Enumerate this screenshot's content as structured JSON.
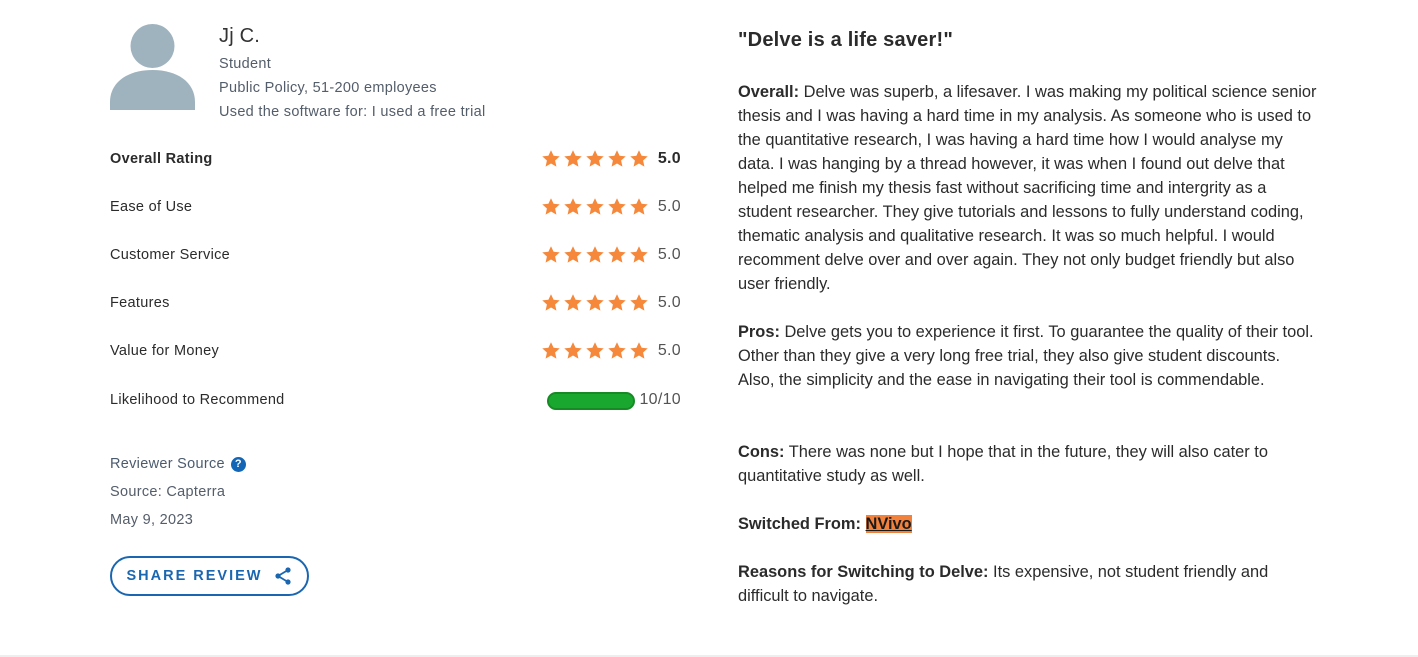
{
  "reviewer": {
    "name": "Jj C.",
    "role": "Student",
    "industry": "Public Policy, 51-200 employees",
    "usage": "Used the software for: I used a free trial"
  },
  "ratings": [
    {
      "label": "Overall Rating",
      "value": "5.0",
      "stars": 5
    },
    {
      "label": "Ease of Use",
      "value": "5.0",
      "stars": 5
    },
    {
      "label": "Customer Service",
      "value": "5.0",
      "stars": 5
    },
    {
      "label": "Features",
      "value": "5.0",
      "stars": 5
    },
    {
      "label": "Value for Money",
      "value": "5.0",
      "stars": 5
    }
  ],
  "recommend": {
    "label": "Likelihood to Recommend",
    "value": "10/10",
    "fraction": 1.0
  },
  "source": {
    "heading": "Reviewer Source",
    "source_text": "Source: Capterra",
    "date": "May 9, 2023"
  },
  "share_label": "SHARE REVIEW",
  "review": {
    "title": "\"Delve is a life saver!\"",
    "overall_label": "Overall:",
    "overall_text": "Delve was superb, a lifesaver. I was making my political science senior thesis and I was having a hard time in my analysis. As someone who is used to the quantitative research, I was having a hard time how I would analyse my data. I was hanging by a thread however, it was when I found out delve that helped me finish my thesis fast without sacrificing time and intergrity as a student researcher. They give tutorials and lessons to fully understand coding, thematic analysis and qualitative research. It was so much helpful. I would recomment delve over and over again. They not only budget friendly but also user friendly.",
    "pros_label": "Pros:",
    "pros_text": "Delve gets you to experience it first. To guarantee the quality of their tool. Other than they give a very long free trial, they also give student discounts. Also, the simplicity and the ease in navigating their tool is commendable.",
    "cons_label": "Cons:",
    "cons_text": "There was none but I hope that in the future, they will also cater to quantitative study as well.",
    "switched_label": "Switched From:",
    "switched_value": "NVivo",
    "reasons_label": "Reasons for Switching to Delve:",
    "reasons_text": "Its expensive, not student friendly and difficult to navigate."
  },
  "colors": {
    "star": "#f5883b",
    "meter": "#1aa72f",
    "link_blue": "#1a66b0",
    "avatar": "#9fb3bf",
    "highlight": "#f2813b"
  },
  "icons": {
    "avatar": "person-silhouette-icon",
    "star": "star-icon",
    "help": "question-icon",
    "share": "share-icon"
  }
}
